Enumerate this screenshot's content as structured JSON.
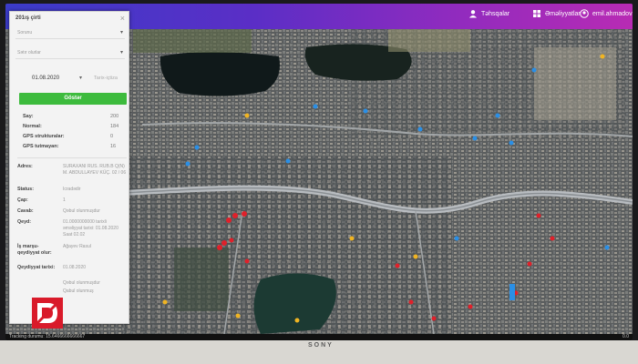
{
  "topbar": {
    "nav": [
      {
        "label": "Təhsqalar",
        "icon": "users-icon"
      },
      {
        "label": "Əməliyyatlar",
        "icon": "grid-icon"
      },
      {
        "label": "emil.ahmadov",
        "icon": "user-icon"
      }
    ]
  },
  "panel": {
    "title": "201ış çirti",
    "close": "×",
    "select1": "Sorunu",
    "select2": "Sətır olurlar",
    "date_from": "01.08.2020",
    "date_to": "Tarix-içtiza",
    "show_button": "Göstər",
    "stats": [
      {
        "label": "Say:",
        "value": "200"
      },
      {
        "label": "Normal:",
        "value": "184"
      },
      {
        "label": "GPS strukturalar:",
        "value": "0"
      },
      {
        "label": "GPS tutmayan:",
        "value": "16"
      }
    ],
    "details": [
      {
        "label": "Adres:",
        "value": "SURAXANI RUS. RUB.B Q(N) M. ABDULLAYEV KÜÇ. 02 / 06"
      },
      {
        "label": "Status:",
        "value": "Icradədir"
      },
      {
        "label": "Çap:",
        "value": "1"
      },
      {
        "label": "Cavab:",
        "value": "Qəbul olunmuşdur"
      },
      {
        "label": "Qeyd:",
        "value": "01.0000000000 tarixli əməliyyat tarixi: 01.08.2020 Saat 02.02"
      },
      {
        "label": "İş marşu-qeydiyyat olur:",
        "value": "Ağayev Rasul"
      },
      {
        "label": "Qeydiyyat tarixi:",
        "value": "01.08.2020"
      },
      {
        "label": "",
        "value": "Qəbul olunmuşdur"
      },
      {
        "label": "",
        "value": "Qabul olunmuş"
      }
    ]
  },
  "statusbar": {
    "left": "Tracking durumu: 15.6466666666667",
    "right": "0.0"
  },
  "tv": {
    "brand": "SONY"
  },
  "colors": {
    "accent": "#3dbb3d",
    "nav_start": "#3b3cc9",
    "nav_end": "#b82bb4",
    "marker_red": "#e0202a",
    "marker_blue": "#2a8fe6",
    "marker_yellow": "#f0b422"
  }
}
